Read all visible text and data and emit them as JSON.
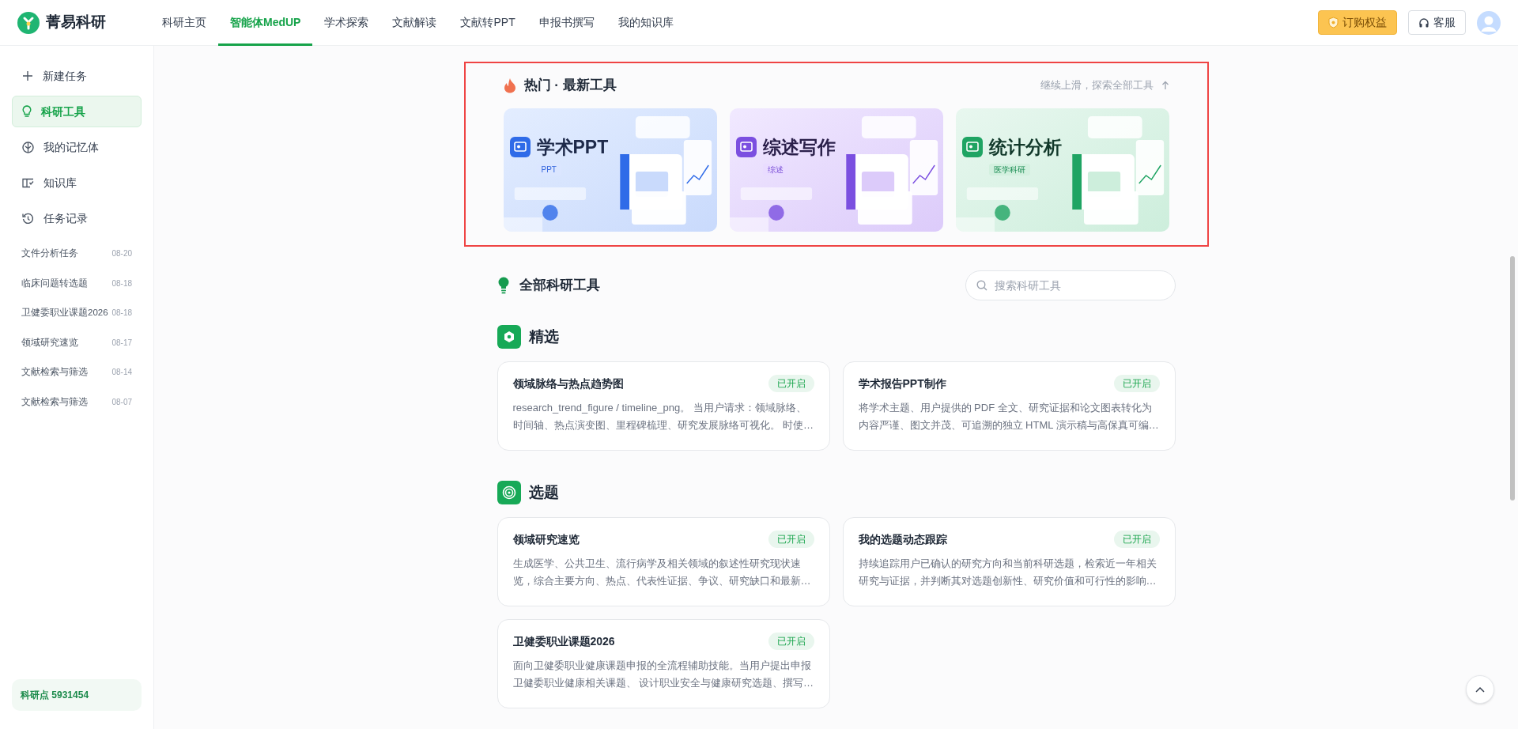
{
  "brand": {
    "name": "菁易科研"
  },
  "nav": [
    {
      "label": "科研主页",
      "selected": false
    },
    {
      "label": "智能体MedUP",
      "selected": true
    },
    {
      "label": "学术探索",
      "selected": false
    },
    {
      "label": "文献解读",
      "selected": false
    },
    {
      "label": "文献转PPT",
      "selected": false
    },
    {
      "label": "申报书撰写",
      "selected": false
    },
    {
      "label": "我的知识库",
      "selected": false
    }
  ],
  "header_buttons": [
    {
      "label": "订购权益",
      "kind": "primary"
    },
    {
      "label": "客服",
      "kind": "outline"
    }
  ],
  "sidebar": {
    "items": [
      {
        "label": "新建任务",
        "selected": false
      },
      {
        "label": "科研工具",
        "selected": true
      },
      {
        "label": "我的记忆体",
        "selected": false
      },
      {
        "label": "知识库",
        "selected": false
      },
      {
        "label": "任务记录",
        "selected": false
      }
    ],
    "tasks": [
      {
        "title": "文件分析任务",
        "date": "08-20"
      },
      {
        "title": "临床问题转选题",
        "date": "08-18"
      },
      {
        "title": "卫健委职业课题2026",
        "date": "08-18"
      },
      {
        "title": "领域研究速览",
        "date": "08-17"
      },
      {
        "title": "文献检索与筛选",
        "date": "08-14"
      },
      {
        "title": "文献检索与筛选",
        "date": "08-07"
      }
    ],
    "points": "科研点 5931454"
  },
  "hot": {
    "title": "热门 · 最新工具",
    "hint": "继续上滑，探索全部工具",
    "banners": [
      {
        "title": "学术PPT",
        "tag": "PPT"
      },
      {
        "title": "综述写作",
        "tag": "综述"
      },
      {
        "title": "统计分析",
        "tag": "医学科研"
      }
    ]
  },
  "all_tools": {
    "title": "全部科研工具",
    "search": {
      "placeholder": "搜索科研工具"
    },
    "categories": [
      {
        "title": "精选",
        "tools": [
          {
            "name": "领域脉络与热点趋势图",
            "badge": "已开启",
            "desc": "research_trend_figure / timeline_png。 当用户请求：领域脉络、时间轴、热点演变图、里程碑梳理、研究发展脉络可视化。 时使…"
          },
          {
            "name": "学术报告PPT制作",
            "badge": "已开启",
            "desc": "将学术主题、用户提供的 PDF 全文、研究证据和论文图表转化为内容严谨、图文并茂、可追溯的独立 HTML 演示稿与高保真可编…"
          }
        ]
      },
      {
        "title": "选题",
        "tools": [
          {
            "name": "领域研究速览",
            "badge": "已开启",
            "desc": "生成医学、公共卫生、流行病学及相关领域的叙述性研究现状速览，综合主要方向、热点、代表性证据、争议、研究缺口和最新…"
          },
          {
            "name": "我的选题动态跟踪",
            "badge": "已开启",
            "desc": "持续追踪用户已确认的研究方向和当前科研选题，检索近一年相关研究与证据，并判断其对选题创新性、研究价值和可行性的影响…"
          },
          {
            "name": "卫健委职业课题2026",
            "badge": "已开启",
            "desc": "面向卫健委职业健康课题申报的全流程辅助技能。当用户提出申报卫健委职业健康相关课题、 设计职业安全与健康研究选题、撰写…"
          }
        ]
      }
    ]
  }
}
